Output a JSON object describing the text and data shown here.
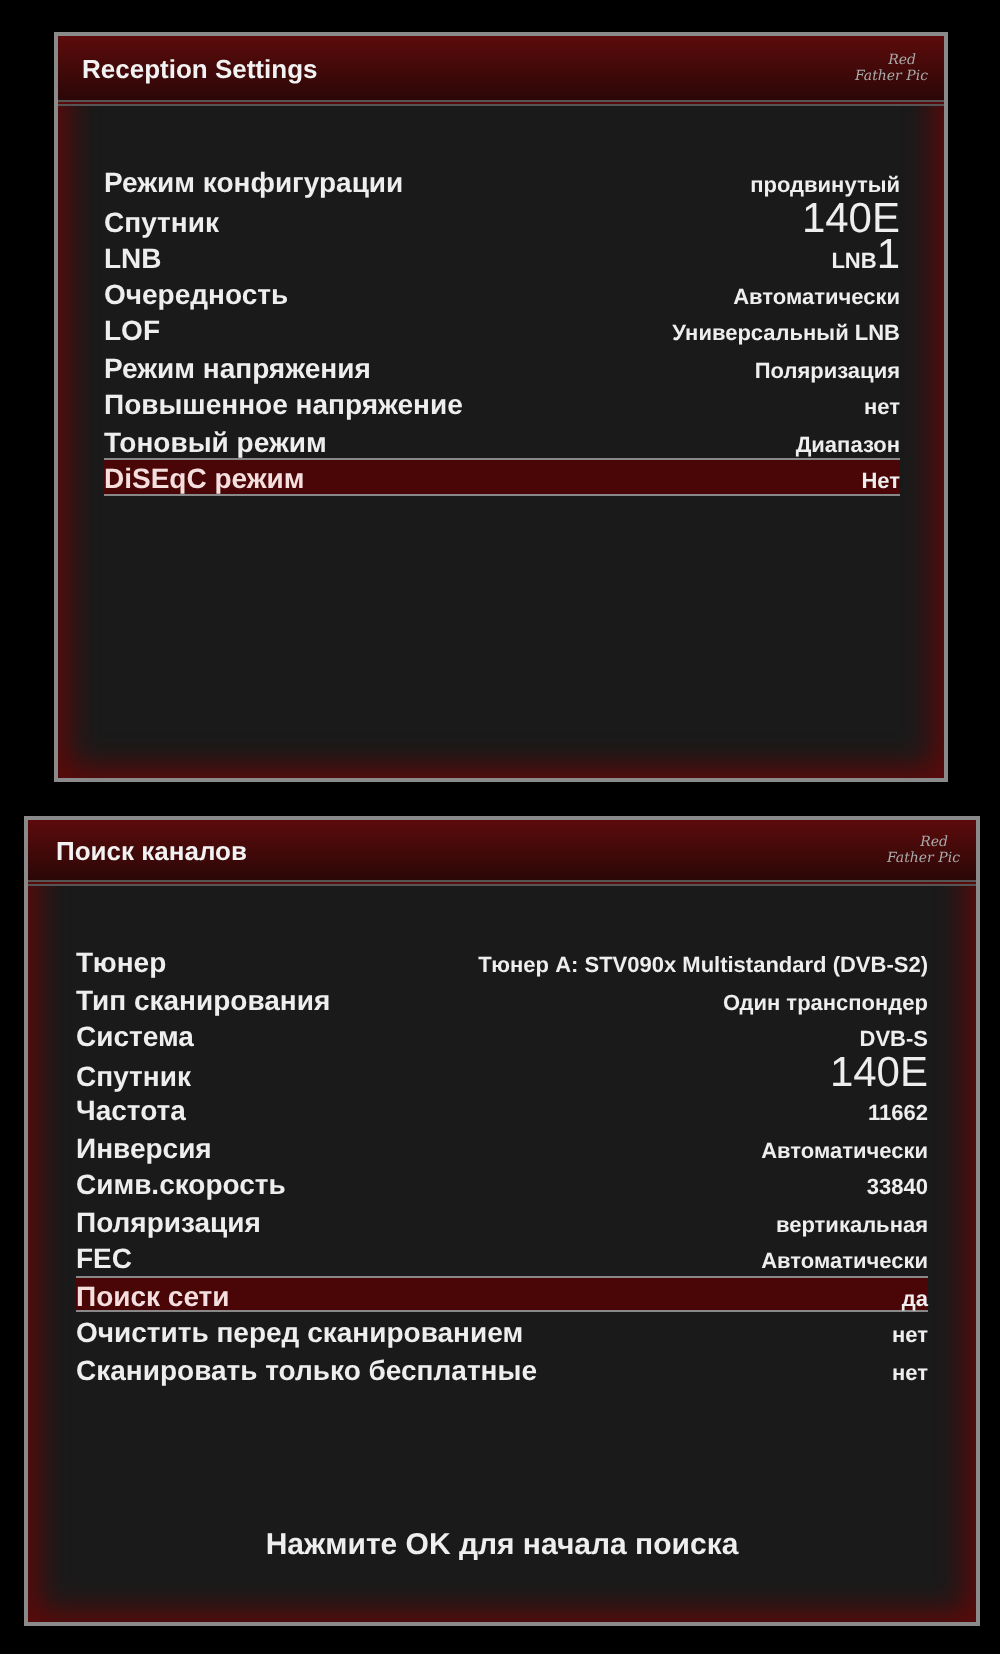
{
  "panels": [
    {
      "title": "Reception Settings",
      "logo": [
        "Red",
        "Father Pic"
      ],
      "rows": [
        {
          "label": "Режим конфигурации",
          "value": "продвинутый",
          "kind": "text",
          "selected": false
        },
        {
          "label": "Спутник",
          "value": "140E",
          "kind": "large",
          "selected": false
        },
        {
          "label": "LNB",
          "value": "LNB",
          "suffix": "1",
          "kind": "suffixed",
          "selected": false
        },
        {
          "label": "Очередность",
          "value": "Автоматически",
          "kind": "text",
          "selected": false
        },
        {
          "label": "LOF",
          "value": "Универсальный LNB",
          "kind": "text",
          "selected": false
        },
        {
          "label": "Режим напряжения",
          "value": "Поляризация",
          "kind": "text",
          "selected": false
        },
        {
          "label": "Повышенное напряжение",
          "value": "нет",
          "kind": "text",
          "selected": false
        },
        {
          "label": "Тоновый режим",
          "value": "Диапазон",
          "kind": "text",
          "selected": false
        },
        {
          "label": "DiSEqC режим",
          "value": "Нет",
          "kind": "text",
          "selected": true
        }
      ]
    },
    {
      "title": "Поиск каналов",
      "logo": [
        "Red",
        "Father Pic"
      ],
      "rows": [
        {
          "label": "Тюнер",
          "value": "Тюнер A: STV090x Multistandard (DVB-S2)",
          "kind": "text",
          "selected": false
        },
        {
          "label": "Тип сканирования",
          "value": "Один транспондер",
          "kind": "text",
          "selected": false
        },
        {
          "label": "Система",
          "value": "DVB-S",
          "kind": "text",
          "selected": false
        },
        {
          "label": "Спутник",
          "value": "140E",
          "kind": "large",
          "selected": false
        },
        {
          "label": "Частота",
          "value": "11662",
          "kind": "text",
          "selected": false
        },
        {
          "label": "Инверсия",
          "value": "Автоматически",
          "kind": "text",
          "selected": false
        },
        {
          "label": "Симв.скорость",
          "value": "33840",
          "kind": "text",
          "selected": false
        },
        {
          "label": "Поляризация",
          "value": "вертикальная",
          "kind": "text",
          "selected": false
        },
        {
          "label": "FEC",
          "value": "Автоматически",
          "kind": "text",
          "selected": false
        },
        {
          "label": "Поиск сети",
          "value": "да",
          "kind": "text",
          "selected": true
        },
        {
          "label": "Очистить перед сканированием",
          "value": "нет",
          "kind": "text",
          "selected": false
        },
        {
          "label": "Сканировать только бесплатные",
          "value": "нет",
          "kind": "text",
          "selected": false
        }
      ],
      "footer": "Нажмите OK для начала поиска"
    }
  ]
}
